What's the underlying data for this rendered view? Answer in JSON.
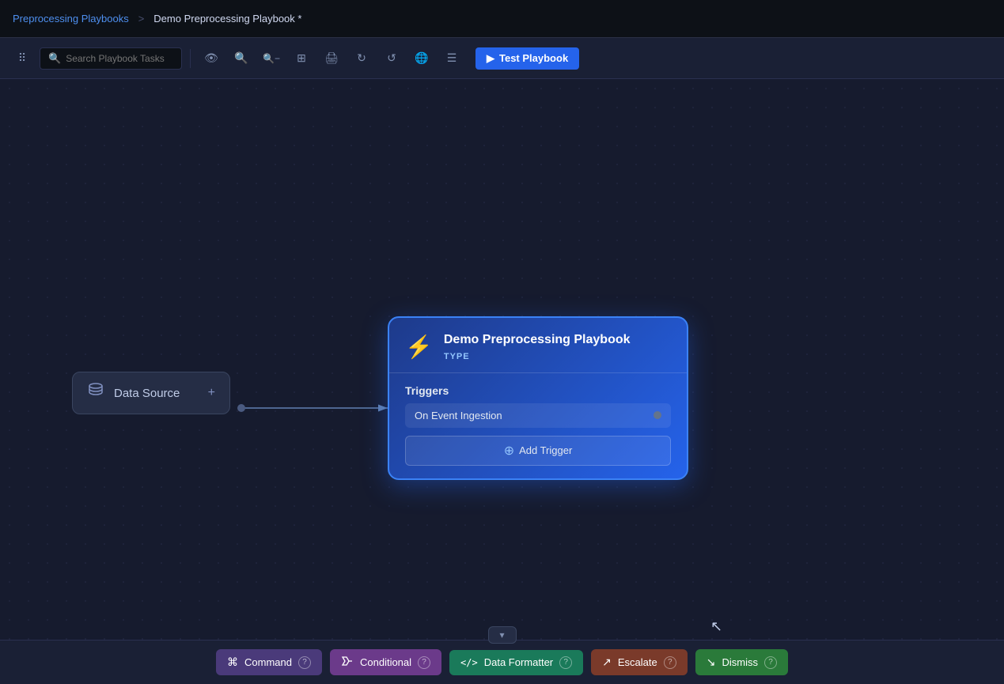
{
  "nav": {
    "parent_link": "Preprocessing Playbooks",
    "separator": ">",
    "current": "Demo Preprocessing Playbook *"
  },
  "toolbar": {
    "search_placeholder": "Search Playbook Tasks",
    "test_button_label": "Test Playbook",
    "icons": [
      "eye",
      "zoom-in",
      "zoom-out",
      "fit",
      "print",
      "refresh",
      "undo",
      "globe",
      "menu"
    ]
  },
  "canvas": {
    "datasource_node": {
      "label": "Data Source",
      "add_label": "+"
    },
    "playbook_node": {
      "title": "Demo Preprocessing Playbook",
      "type_label": "TYPE",
      "triggers_label": "Triggers",
      "trigger_name": "On Event Ingestion",
      "add_trigger_label": "Add Trigger"
    }
  },
  "bottom_panel": {
    "toggle_icon": "▾",
    "chips": [
      {
        "id": "command",
        "icon": "⌘",
        "label": "Command",
        "color": "chip-command"
      },
      {
        "id": "conditional",
        "icon": "⇒",
        "label": "Conditional",
        "color": "chip-conditional"
      },
      {
        "id": "formatter",
        "icon": "</>",
        "label": "Data Formatter",
        "color": "chip-formatter"
      },
      {
        "id": "escalate",
        "icon": "↗",
        "label": "Escalate",
        "color": "chip-escalate"
      },
      {
        "id": "dismiss",
        "icon": "↘",
        "label": "Dismiss",
        "color": "chip-dismiss"
      }
    ]
  }
}
